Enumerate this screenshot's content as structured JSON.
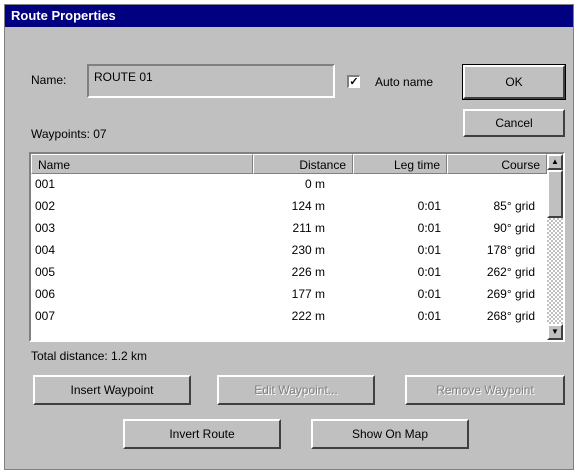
{
  "window": {
    "title": "Route Properties"
  },
  "name_field": {
    "label": "Name:",
    "value": "ROUTE 01"
  },
  "auto_name": {
    "label": "Auto name",
    "checked": true
  },
  "buttons": {
    "ok": "OK",
    "cancel": "Cancel",
    "insert_waypoint": "Insert Waypoint",
    "edit_waypoint": "Edit Waypoint...",
    "remove_waypoint": "Remove Waypoint",
    "invert_route": "Invert Route",
    "show_on_map": "Show On Map"
  },
  "waypoint_summary": "Waypoints: 07",
  "columns": {
    "name": "Name",
    "distance": "Distance",
    "leg_time": "Leg time",
    "course": "Course"
  },
  "rows": [
    {
      "name": "001",
      "distance": "0 m",
      "leg_time": "",
      "course": ""
    },
    {
      "name": "002",
      "distance": "124 m",
      "leg_time": "0:01",
      "course": "85° grid"
    },
    {
      "name": "003",
      "distance": "211 m",
      "leg_time": "0:01",
      "course": "90° grid"
    },
    {
      "name": "004",
      "distance": "230 m",
      "leg_time": "0:01",
      "course": "178° grid"
    },
    {
      "name": "005",
      "distance": "226 m",
      "leg_time": "0:01",
      "course": "262° grid"
    },
    {
      "name": "006",
      "distance": "177 m",
      "leg_time": "0:01",
      "course": "269° grid"
    },
    {
      "name": "007",
      "distance": "222 m",
      "leg_time": "0:01",
      "course": "268° grid"
    }
  ],
  "total_distance": "Total distance: 1.2 km",
  "colors": {
    "title_bar": "#000080",
    "face": "#c0c0c0"
  }
}
